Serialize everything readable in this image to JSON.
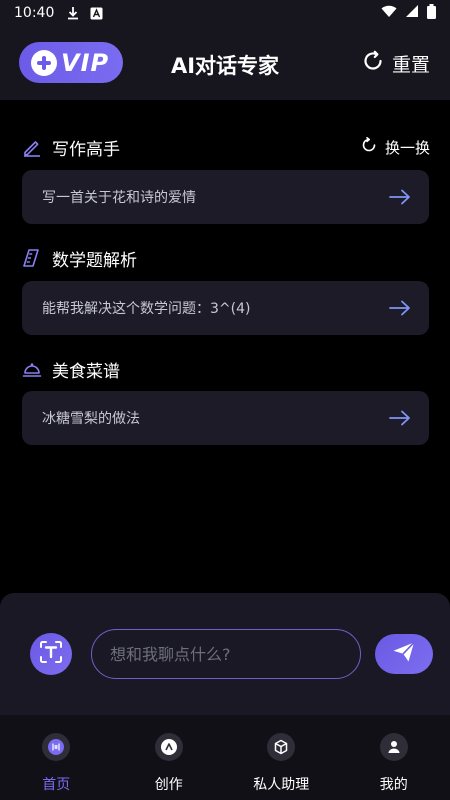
{
  "status_bar": {
    "time": "10:40",
    "icons": [
      "download-icon",
      "notification-a-icon",
      "wifi-icon",
      "signal-icon",
      "battery-icon"
    ]
  },
  "header": {
    "vip_label": "VIP",
    "title": "AI对话专家",
    "reset_label": "重置"
  },
  "sections": [
    {
      "title": "写作高手",
      "icon": "pencil-icon",
      "refresh_label": "换一换",
      "prompt": "写一首关于花和诗的爱情"
    },
    {
      "title": "数学题解析",
      "icon": "ruler-icon",
      "prompt": "能帮我解决这个数学问题：3^(4)"
    },
    {
      "title": "美食菜谱",
      "icon": "food-cloche-icon",
      "prompt": "冰糖雪梨的做法"
    }
  ],
  "input": {
    "placeholder": "想和我聊点什么?",
    "value": ""
  },
  "nav": {
    "items": [
      {
        "label": "首页",
        "icon": "home-chat-icon",
        "active": true
      },
      {
        "label": "创作",
        "icon": "create-icon",
        "active": false
      },
      {
        "label": "私人助理",
        "icon": "assistant-cube-icon",
        "active": false
      },
      {
        "label": "我的",
        "icon": "profile-icon",
        "active": false
      }
    ]
  },
  "colors": {
    "accent": "#7a6cf0",
    "background": "#000000",
    "card": "#1c1b27",
    "panel": "#191824"
  }
}
